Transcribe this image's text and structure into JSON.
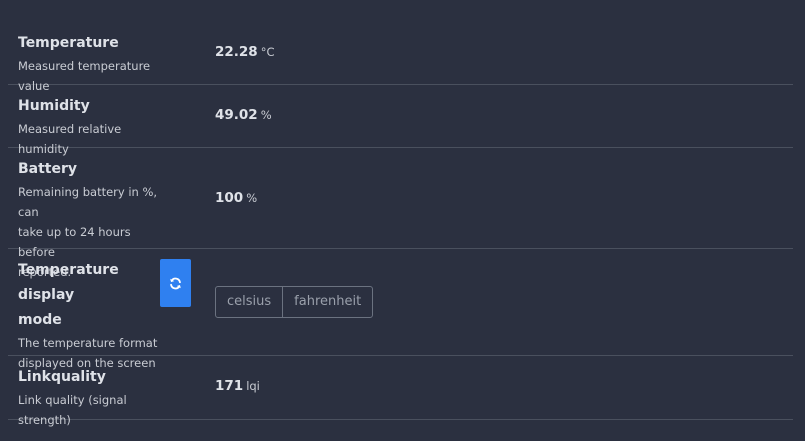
{
  "rows": [
    {
      "title": "Temperature",
      "description": "Measured temperature value",
      "value": "22.28",
      "unit": "°C"
    },
    {
      "title": "Humidity",
      "description": "Measured relative humidity",
      "value": "49.02",
      "unit": "%"
    },
    {
      "title": "Battery",
      "description_lines": [
        "Remaining battery in %, can",
        "take up to 24 hours before",
        "reported."
      ],
      "value": "100",
      "unit": "%"
    },
    {
      "title_lines": [
        "Temperature display",
        "mode"
      ],
      "description_lines": [
        "The temperature format",
        "displayed on the screen"
      ],
      "refresh_icon": "refresh-icon",
      "options": [
        "celsius",
        "fahrenheit"
      ]
    },
    {
      "title": "Linkquality",
      "description": "Link quality (signal strength)",
      "value": "171",
      "unit": "lqi"
    }
  ],
  "colors": {
    "background": "#2b3040",
    "accent": "#2f80f0",
    "divider": "#4a505e"
  }
}
